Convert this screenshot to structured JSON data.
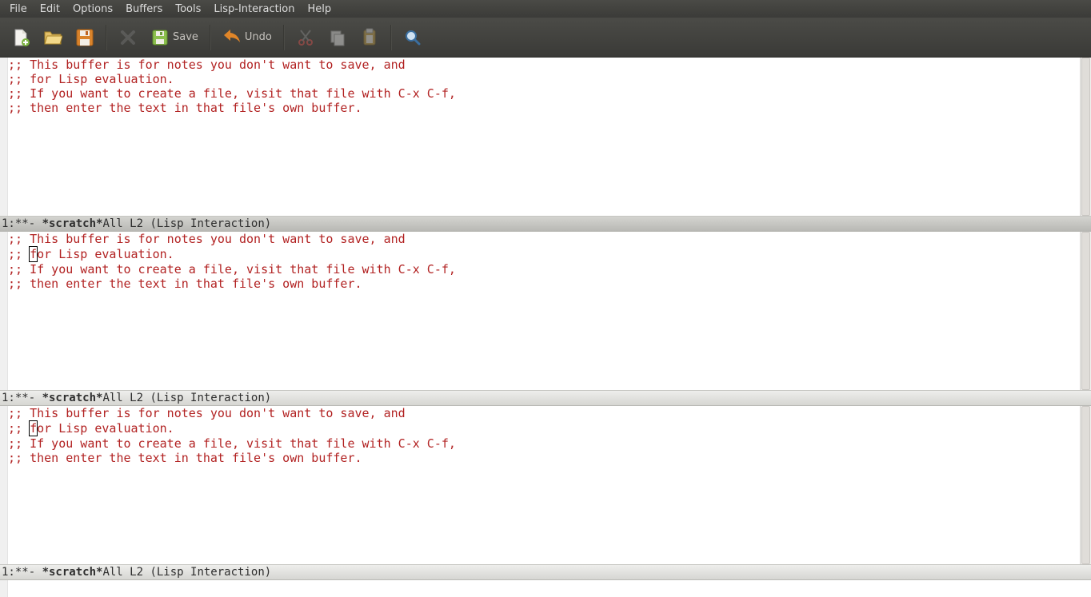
{
  "menu": {
    "file": "File",
    "edit": "Edit",
    "options": "Options",
    "buffers": "Buffers",
    "tools": "Tools",
    "lisp_interaction": "Lisp-Interaction",
    "help": "Help"
  },
  "toolbar": {
    "save_label": "Save",
    "undo_label": "Undo"
  },
  "buffer_text": {
    "line1": ";; This buffer is for notes you don't want to save, and",
    "line2_pre": ";; ",
    "line2_cursor": "f",
    "line2_post": "or Lisp evaluation.",
    "line2_full": ";; for Lisp evaluation.",
    "line3": ";; If you want to create a file, visit that file with C-x C-f,",
    "line4": ";; then enter the text in that file's own buffer."
  },
  "modeline": {
    "left": "1:**-  ",
    "buffer_name": "*scratch*",
    "pad": "      ",
    "pos": "All L2    ",
    "mode": "(Lisp Interaction)"
  }
}
